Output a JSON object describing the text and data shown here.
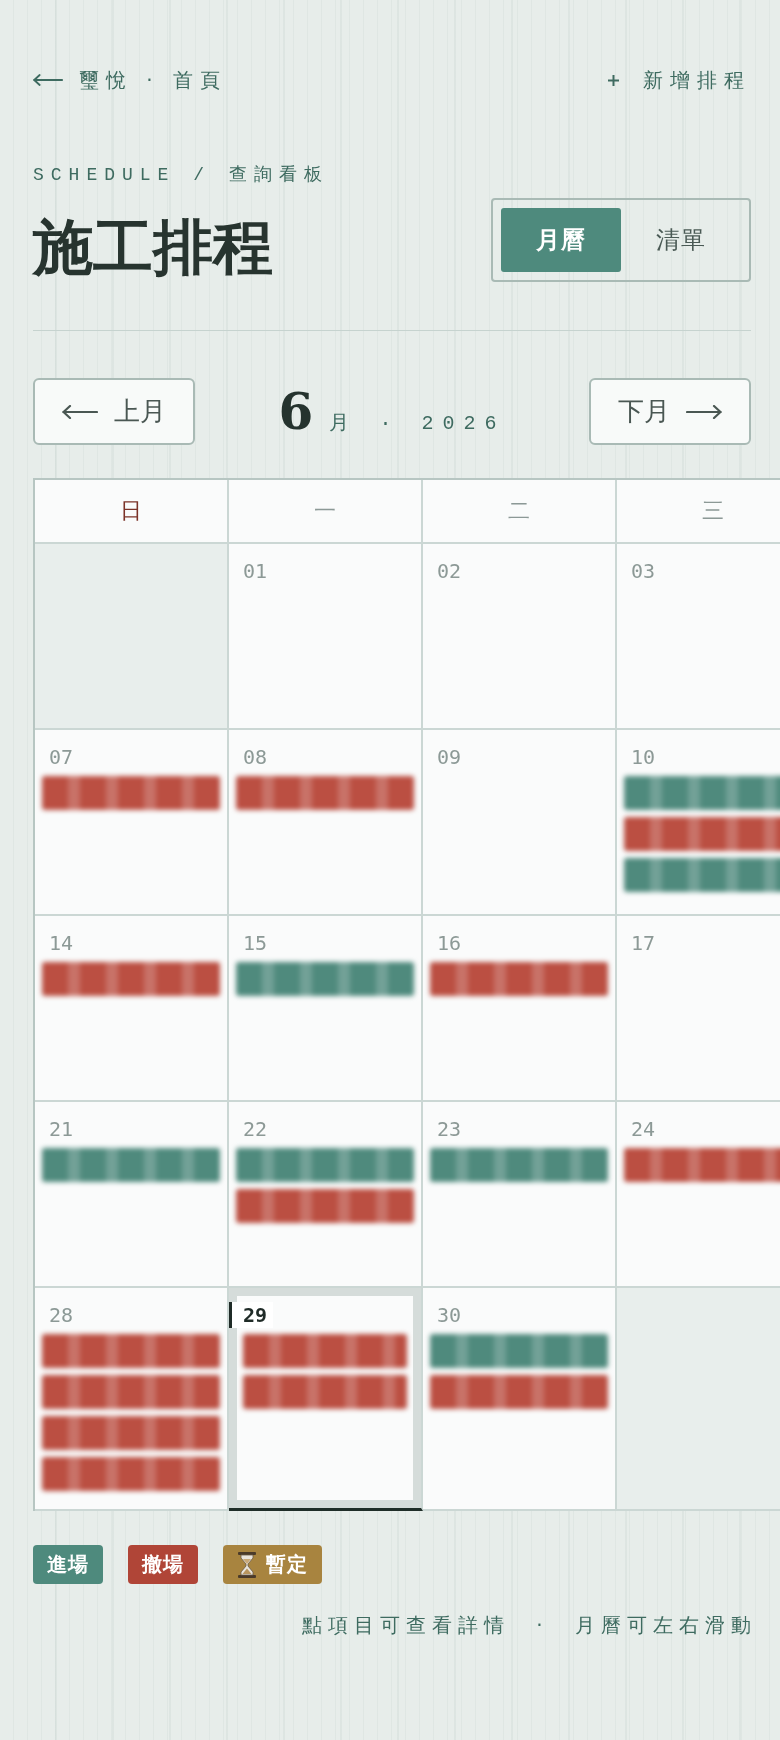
{
  "nav": {
    "back": {
      "label": "璽悅 · 首頁"
    },
    "add": {
      "label": "新增排程"
    }
  },
  "header": {
    "eyebrow": "SCHEDULE / 查詢看板",
    "title": "施工排程",
    "views": [
      {
        "label": "月曆",
        "selected": true
      },
      {
        "label": "清單",
        "selected": false
      }
    ]
  },
  "month_nav": {
    "prev": "上月",
    "next": "下月",
    "month": "6",
    "rest": "月 · 2026"
  },
  "calendar": {
    "weekdays": [
      {
        "label": "日",
        "color": "#7b3329"
      },
      {
        "label": "一",
        "color": "#8c9996"
      },
      {
        "label": "二",
        "color": "#8c9996"
      },
      {
        "label": "三",
        "color": "#8c9996"
      }
    ],
    "weeks": [
      {
        "days": [
          {
            "kind": "blank"
          },
          {
            "kind": "day",
            "date": "01",
            "today": false
          },
          {
            "kind": "day",
            "date": "02",
            "today": false
          },
          {
            "kind": "day",
            "date": "03",
            "today": false
          }
        ]
      },
      {
        "days": [
          {
            "kind": "day",
            "date": "07",
            "today": false,
            "events": [
              {
                "kind": "exit"
              }
            ]
          },
          {
            "kind": "day",
            "date": "08",
            "today": false,
            "events": [
              {
                "kind": "exit"
              }
            ]
          },
          {
            "kind": "day",
            "date": "09",
            "today": false
          },
          {
            "kind": "day",
            "date": "10",
            "today": false,
            "events": [
              {
                "kind": "enter"
              },
              {
                "kind": "exit"
              },
              {
                "kind": "enter"
              }
            ]
          }
        ]
      },
      {
        "days": [
          {
            "kind": "day",
            "date": "14",
            "today": false,
            "events": [
              {
                "kind": "exit"
              }
            ]
          },
          {
            "kind": "day",
            "date": "15",
            "today": false,
            "events": [
              {
                "kind": "enter"
              }
            ]
          },
          {
            "kind": "day",
            "date": "16",
            "today": false,
            "events": [
              {
                "kind": "exit"
              }
            ]
          },
          {
            "kind": "day",
            "date": "17",
            "today": false
          }
        ]
      },
      {
        "days": [
          {
            "kind": "day",
            "date": "21",
            "today": false,
            "events": [
              {
                "kind": "enter"
              }
            ]
          },
          {
            "kind": "day",
            "date": "22",
            "today": false,
            "events": [
              {
                "kind": "enter"
              },
              {
                "kind": "exit"
              }
            ]
          },
          {
            "kind": "day",
            "date": "23",
            "today": false,
            "events": [
              {
                "kind": "enter"
              }
            ]
          },
          {
            "kind": "day",
            "date": "24",
            "today": false,
            "events": [
              {
                "kind": "exit"
              }
            ]
          }
        ]
      },
      {
        "days": [
          {
            "kind": "day",
            "date": "28",
            "today": false,
            "events": [
              {
                "kind": "exit"
              },
              {
                "kind": "exit"
              },
              {
                "kind": "exit"
              },
              {
                "kind": "exit"
              }
            ]
          },
          {
            "kind": "day",
            "date": "29",
            "today": true,
            "events": [
              {
                "kind": "exit"
              },
              {
                "kind": "exit"
              }
            ]
          },
          {
            "kind": "day",
            "date": "30",
            "today": false,
            "events": [
              {
                "kind": "enter"
              },
              {
                "kind": "exit"
              }
            ]
          },
          {
            "kind": "blank"
          }
        ]
      }
    ]
  },
  "legend": [
    {
      "label": "進場",
      "color": "#4e8a7d",
      "kind": "plain"
    },
    {
      "label": "撤場",
      "color": "#b04537",
      "kind": "plain"
    },
    {
      "label": "暫定",
      "color": "#a8843f",
      "kind": "tentative"
    }
  ],
  "hint": "點項目可查看詳情 · 月曆可左右滑動"
}
